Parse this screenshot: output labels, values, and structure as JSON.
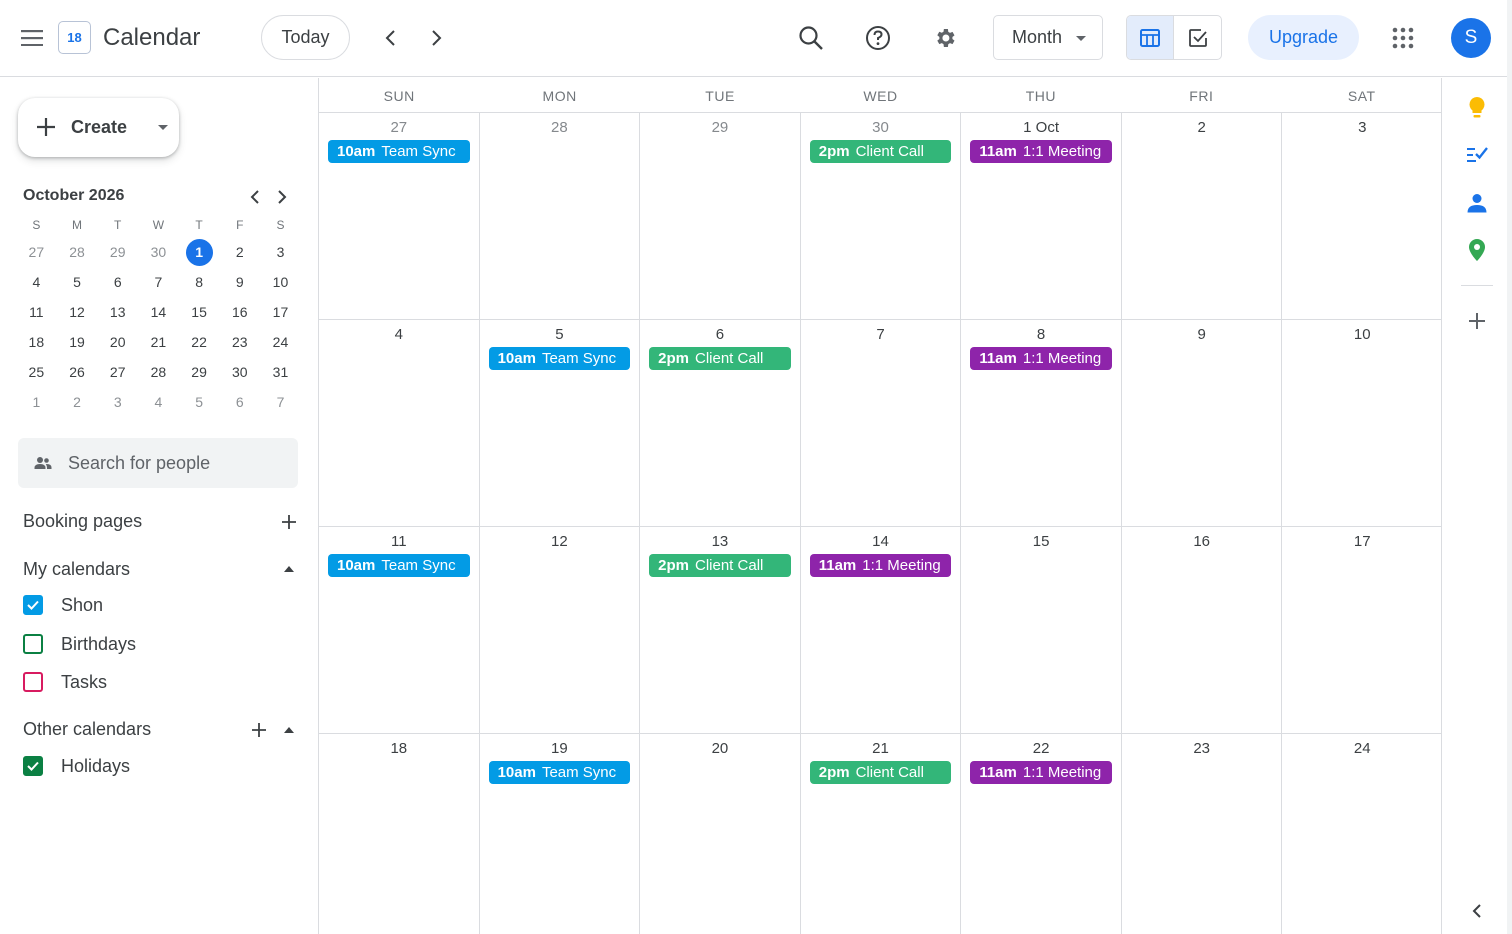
{
  "header": {
    "logo_date": "18",
    "title": "Calendar",
    "today_label": "Today",
    "view_label": "Month",
    "upgrade_label": "Upgrade",
    "avatar_initial": "S"
  },
  "sidebar": {
    "create_label": "Create",
    "mini_month_title": "October 2026",
    "mini_weekdays": [
      "S",
      "M",
      "T",
      "W",
      "T",
      "F",
      "S"
    ],
    "mini_weeks": [
      [
        "27",
        "28",
        "29",
        "30",
        "1",
        "2",
        "3"
      ],
      [
        "4",
        "5",
        "6",
        "7",
        "8",
        "9",
        "10"
      ],
      [
        "11",
        "12",
        "13",
        "14",
        "15",
        "16",
        "17"
      ],
      [
        "18",
        "19",
        "20",
        "21",
        "22",
        "23",
        "24"
      ],
      [
        "25",
        "26",
        "27",
        "28",
        "29",
        "30",
        "31"
      ],
      [
        "1",
        "2",
        "3",
        "4",
        "5",
        "6",
        "7"
      ]
    ],
    "search_people_placeholder": "Search for people",
    "booking_pages_label": "Booking pages",
    "my_calendars_label": "My calendars",
    "my_calendars": [
      {
        "name": "Shon",
        "checked": true,
        "color": "#039be5"
      },
      {
        "name": "Birthdays",
        "checked": false,
        "color": "#0b8043"
      },
      {
        "name": "Tasks",
        "checked": false,
        "color": "#d81b60"
      }
    ],
    "other_calendars_label": "Other calendars",
    "other_calendars": [
      {
        "name": "Holidays",
        "checked": true,
        "color": "#0b8043"
      }
    ]
  },
  "month": {
    "weekdays": [
      "SUN",
      "MON",
      "TUE",
      "WED",
      "THU",
      "FRI",
      "SAT"
    ],
    "weeks": [
      [
        {
          "label": "27",
          "dim": true,
          "events": [
            {
              "time": "10am",
              "title": "Team Sync",
              "color": "#039be5"
            }
          ]
        },
        {
          "label": "28",
          "dim": true,
          "events": []
        },
        {
          "label": "29",
          "dim": true,
          "events": []
        },
        {
          "label": "30",
          "dim": true,
          "events": [
            {
              "time": "2pm",
              "title": "Client Call",
              "color": "#33b679"
            }
          ]
        },
        {
          "label": "1 Oct",
          "dim": false,
          "events": [
            {
              "time": "11am",
              "title": "1:1 Meeting",
              "color": "#8e24aa"
            }
          ]
        },
        {
          "label": "2",
          "dim": false,
          "events": []
        },
        {
          "label": "3",
          "dim": false,
          "events": []
        }
      ],
      [
        {
          "label": "4",
          "dim": false,
          "events": []
        },
        {
          "label": "5",
          "dim": false,
          "events": [
            {
              "time": "10am",
              "title": "Team Sync",
              "color": "#039be5"
            }
          ]
        },
        {
          "label": "6",
          "dim": false,
          "events": [
            {
              "time": "2pm",
              "title": "Client Call",
              "color": "#33b679"
            }
          ]
        },
        {
          "label": "7",
          "dim": false,
          "events": []
        },
        {
          "label": "8",
          "dim": false,
          "events": [
            {
              "time": "11am",
              "title": "1:1 Meeting",
              "color": "#8e24aa"
            }
          ]
        },
        {
          "label": "9",
          "dim": false,
          "events": []
        },
        {
          "label": "10",
          "dim": false,
          "events": []
        }
      ],
      [
        {
          "label": "11",
          "dim": false,
          "events": [
            {
              "time": "10am",
              "title": "Team Sync",
              "color": "#039be5"
            }
          ]
        },
        {
          "label": "12",
          "dim": false,
          "events": []
        },
        {
          "label": "13",
          "dim": false,
          "events": [
            {
              "time": "2pm",
              "title": "Client Call",
              "color": "#33b679"
            }
          ]
        },
        {
          "label": "14",
          "dim": false,
          "events": [
            {
              "time": "11am",
              "title": "1:1 Meeting",
              "color": "#8e24aa"
            }
          ]
        },
        {
          "label": "15",
          "dim": false,
          "events": []
        },
        {
          "label": "16",
          "dim": false,
          "events": []
        },
        {
          "label": "17",
          "dim": false,
          "events": []
        }
      ],
      [
        {
          "label": "18",
          "dim": false,
          "events": []
        },
        {
          "label": "19",
          "dim": false,
          "events": [
            {
              "time": "10am",
              "title": "Team Sync",
              "color": "#039be5"
            }
          ]
        },
        {
          "label": "20",
          "dim": false,
          "events": []
        },
        {
          "label": "21",
          "dim": false,
          "events": [
            {
              "time": "2pm",
              "title": "Client Call",
              "color": "#33b679"
            }
          ]
        },
        {
          "label": "22",
          "dim": false,
          "events": [
            {
              "time": "11am",
              "title": "1:1 Meeting",
              "color": "#8e24aa"
            }
          ]
        },
        {
          "label": "23",
          "dim": false,
          "events": []
        },
        {
          "label": "24",
          "dim": false,
          "events": []
        }
      ]
    ]
  },
  "colors": {
    "accent": "#1a73e8",
    "team_sync": "#039be5",
    "client_call": "#33b679",
    "one_on_one": "#8e24aa"
  },
  "rail_icons": [
    "keep-icon",
    "tasks-icon",
    "contacts-icon",
    "maps-icon",
    "add-icon",
    "collapse-chevron-icon"
  ]
}
